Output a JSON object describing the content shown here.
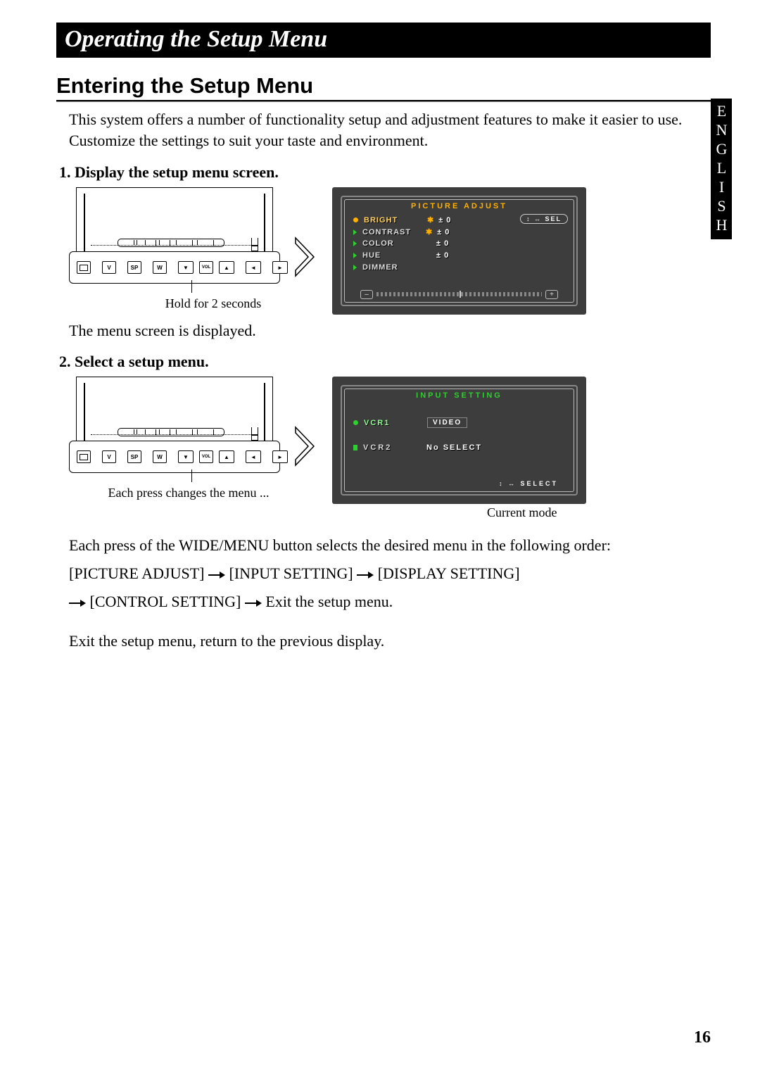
{
  "language_tab": "ENGLISH",
  "chapter_title": "Operating the Setup Menu",
  "section_heading": "Entering the Setup Menu",
  "intro": "This system offers a number of functionality setup and adjustment features to make it easier to use. Customize the settings to suit your taste and environment.",
  "step1": {
    "title": "1. Display the setup menu screen.",
    "hold_caption": "Hold for 2 seconds",
    "after": "The menu screen is displayed."
  },
  "step2": {
    "title": "2. Select a setup menu.",
    "each_press_caption": "Each press changes the menu ...",
    "current_mode_caption": "Current mode"
  },
  "sequence": {
    "line1_pre": "Each press of the WIDE/MENU button selects the desired menu in the following order:",
    "items": [
      "[PICTURE ADJUST]",
      "[INPUT SETTING]",
      "[DISPLAY SETTING]",
      "[CONTROL SETTING]",
      "Exit the setup menu."
    ]
  },
  "exit_text": "Exit the setup menu, return to the previous display.",
  "page_number": "16",
  "osd1": {
    "title": "PICTURE ADJUST",
    "sel_label": "SEL",
    "rows": [
      {
        "label": "BRIGHT",
        "value": "± 0",
        "marker": "dot",
        "highlight": true,
        "star": true
      },
      {
        "label": "CONTRAST",
        "value": "± 0",
        "marker": "tri",
        "star": true
      },
      {
        "label": "COLOR",
        "value": "± 0",
        "marker": "tri"
      },
      {
        "label": "HUE",
        "value": "± 0",
        "marker": "tri"
      },
      {
        "label": "DIMMER",
        "value": "",
        "marker": "tri"
      }
    ],
    "bar": {
      "minus": "–",
      "plus": "+"
    }
  },
  "osd2": {
    "title": "INPUT SETTING",
    "rows": [
      {
        "label": "VCR1",
        "value": "VIDEO",
        "marker": "dot"
      },
      {
        "label": "VCR2",
        "value": "No SELECT",
        "marker": "sq"
      }
    ],
    "hint": "SELECT"
  },
  "panel_buttons": [
    "V",
    "SP",
    "W",
    "▼",
    "VOL",
    "▲",
    "◄",
    "►"
  ]
}
